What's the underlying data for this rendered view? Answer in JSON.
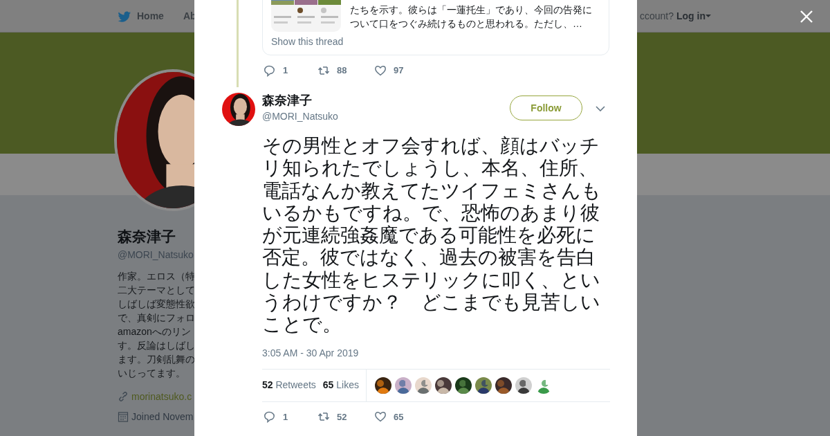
{
  "nav": {
    "items": [
      "Home",
      "Ab"
    ],
    "login_prompt": "ccount?",
    "login": "Log in"
  },
  "profile": {
    "name": "森奈津子",
    "handle": "@MORI_Natsuko",
    "bio_lines": [
      "作家。エロス（特",
      "二大テーマとして",
      "しばしば変態性欲",
      "で、真剣にフォロ",
      "amazonへのリン",
      "す。反論はしばし",
      "ます。刀剣乱舞の",
      "いじってます。"
    ],
    "website": "morinatsuko.c",
    "joined": "Joined Novem"
  },
  "quoted": {
    "lines": [
      "たちを示す。彼らは「一蓮托生」であり、今回の告発に",
      "ついて口をつぐみ続けるものと思われる。ただし、…"
    ],
    "show_thread": "Show this thread",
    "replies": "1",
    "retweets": "88",
    "likes": "97"
  },
  "tweet": {
    "name": "森奈津子",
    "handle": "@MORI_Natsuko",
    "follow": "Follow",
    "text": "その男性とオフ会すれば、顔はバッチリ知られたでしょうし、本名、住所、電話なんか教えてたツイフェミさんもいるかもですね。で、恐怖のあまり彼が元連続強姦魔である可能性を必死に否定。彼ではなく、過去の被害を告白した女性をヒステリックに叩く、というわけですか？　どこまでも見苦しいことで。",
    "time": "3:05 AM - 30 Apr 2019",
    "retweet_count": "52",
    "retweet_label": "Retweets",
    "like_count": "65",
    "like_label": "Likes",
    "replies": "1",
    "retweets": "52",
    "likes": "65"
  }
}
